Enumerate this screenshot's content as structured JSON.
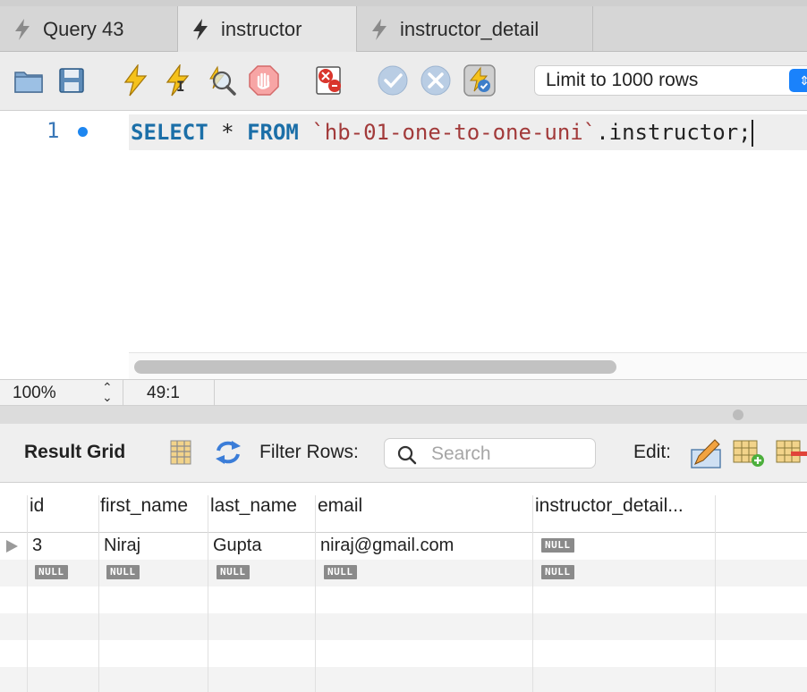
{
  "tabs": [
    {
      "label": "Query 43"
    },
    {
      "label": "instructor"
    },
    {
      "label": "instructor_detail"
    }
  ],
  "toolbar": {
    "limit_label": "Limit to 1000 rows"
  },
  "editor": {
    "line_number": "1",
    "keyword_select": "SELECT",
    "star": "*",
    "keyword_from": "FROM",
    "schema": "`hb-01-one-to-one-uni`",
    "table": ".instructor;"
  },
  "status": {
    "zoom": "100%",
    "cursor": "49:1"
  },
  "results": {
    "title": "Result Grid",
    "filter_label": "Filter Rows:",
    "search_placeholder": "Search",
    "edit_label": "Edit:",
    "columns": [
      "id",
      "first_name",
      "last_name",
      "email",
      "instructor_detail..."
    ],
    "rows": [
      [
        "3",
        "Niraj",
        "Gupta",
        "niraj@gmail.com",
        "NULL"
      ],
      [
        "NULL",
        "NULL",
        "NULL",
        "NULL",
        "NULL"
      ]
    ]
  },
  "colors": {
    "keyword": "#1b6fa8",
    "string": "#a23a3a",
    "accent": "#1a82fb"
  }
}
